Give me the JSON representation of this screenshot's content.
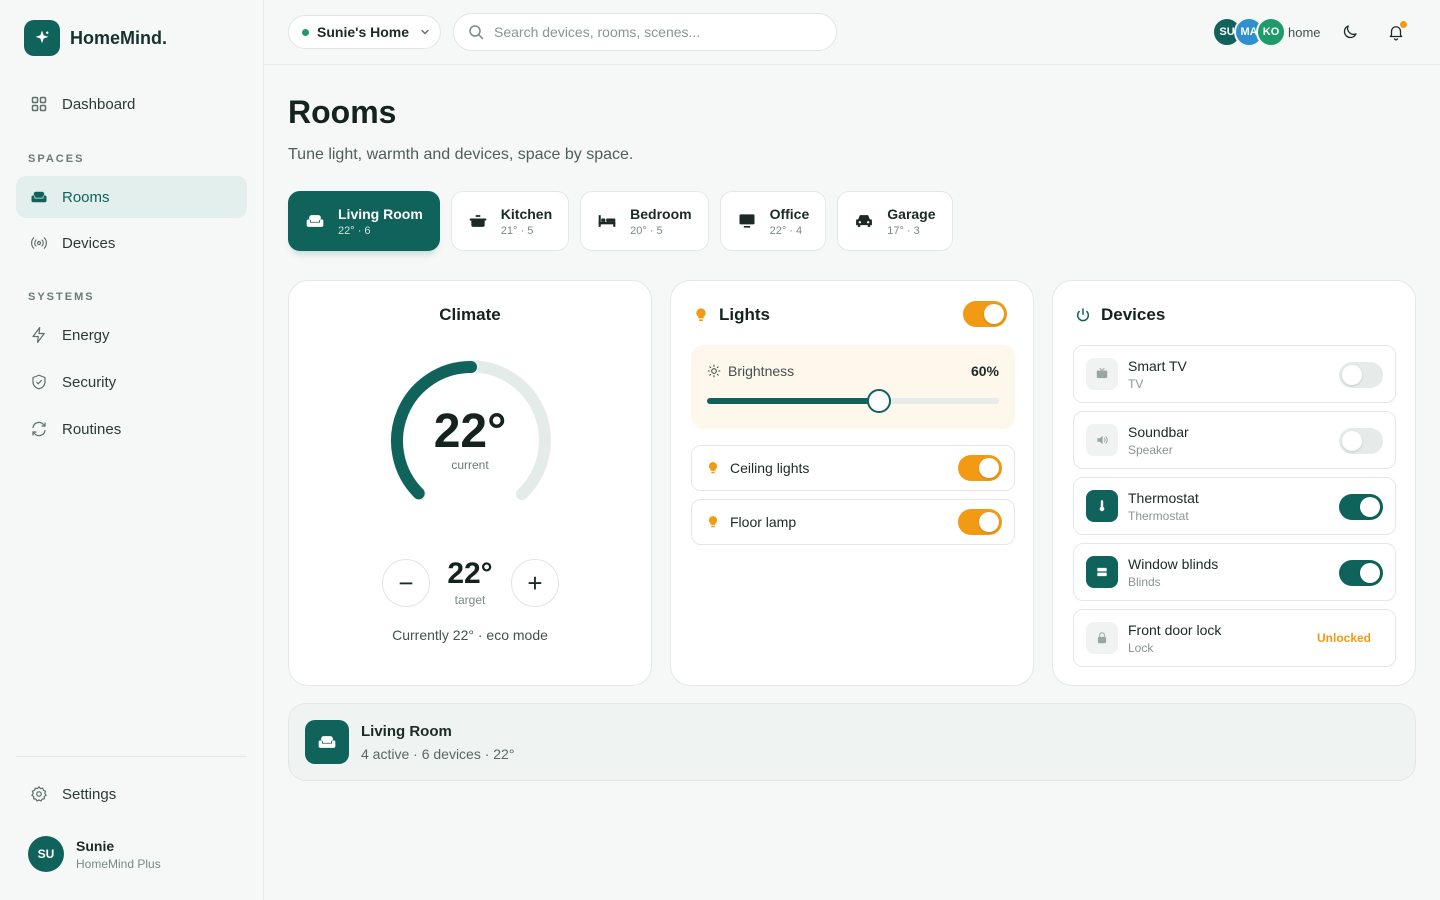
{
  "brand": {
    "name": "HomeMind.",
    "logo_icon": "sparkle-icon"
  },
  "sidebar": {
    "dashboard": "Dashboard",
    "section_spaces": "SPACES",
    "rooms": "Rooms",
    "devices": "Devices",
    "section_systems": "SYSTEMS",
    "energy": "Energy",
    "security": "Security",
    "routines": "Routines",
    "settings": "Settings",
    "active_item": "Rooms",
    "user": {
      "initials": "SU",
      "name": "Sunie",
      "plan": "HomeMind Plus"
    }
  },
  "topbar": {
    "home_name": "Sunie's Home",
    "search_placeholder": "Search devices, rooms, scenes...",
    "avatars": [
      {
        "initials": "SU",
        "color": "#10635a"
      },
      {
        "initials": "MA",
        "color": "#2f8fd0"
      },
      {
        "initials": "KO",
        "color": "#1f9a6b"
      }
    ],
    "avatars_label": "home",
    "notification_dot": true
  },
  "page": {
    "title": "Rooms",
    "subtitle": "Tune light, warmth and devices, space by space."
  },
  "rooms": [
    {
      "name": "Living Room",
      "meta": "22° · 6",
      "icon": "sofa-icon",
      "active": true
    },
    {
      "name": "Kitchen",
      "meta": "21° · 5",
      "icon": "pot-icon",
      "active": false
    },
    {
      "name": "Bedroom",
      "meta": "20° · 5",
      "icon": "bed-icon",
      "active": false
    },
    {
      "name": "Office",
      "meta": "22° · 4",
      "icon": "monitor-icon",
      "active": false
    },
    {
      "name": "Garage",
      "meta": "17° · 3",
      "icon": "car-icon",
      "active": false
    }
  ],
  "climate": {
    "title": "Climate",
    "current": "22°",
    "current_label": "current",
    "target": "22°",
    "target_label": "target",
    "footer": "Currently 22° · eco mode",
    "gauge_fraction": 0.5,
    "minus": "−",
    "plus": "+"
  },
  "lights": {
    "title": "Lights",
    "master_on": true,
    "brightness_label": "Brightness",
    "brightness_value": "60%",
    "brightness_fraction": 0.59,
    "items": [
      {
        "name": "Ceiling lights",
        "on": true
      },
      {
        "name": "Floor lamp",
        "on": true
      }
    ]
  },
  "devices": {
    "title": "Devices",
    "items": [
      {
        "name": "Smart TV",
        "type": "TV",
        "on": false,
        "icon": "tv-icon"
      },
      {
        "name": "Soundbar",
        "type": "Speaker",
        "on": false,
        "icon": "speaker-icon"
      },
      {
        "name": "Thermostat",
        "type": "Thermostat",
        "on": true,
        "icon": "thermometer-icon"
      },
      {
        "name": "Window blinds",
        "type": "Blinds",
        "on": true,
        "icon": "blinds-icon"
      },
      {
        "name": "Front door lock",
        "type": "Lock",
        "status": "Unlocked",
        "icon": "lock-icon"
      }
    ]
  },
  "summary": {
    "title": "Living Room",
    "subtitle": "4 active · 6 devices · 22°"
  },
  "colors": {
    "primary": "#10635a",
    "accent": "#f29a14",
    "background": "#f6f8f7"
  }
}
